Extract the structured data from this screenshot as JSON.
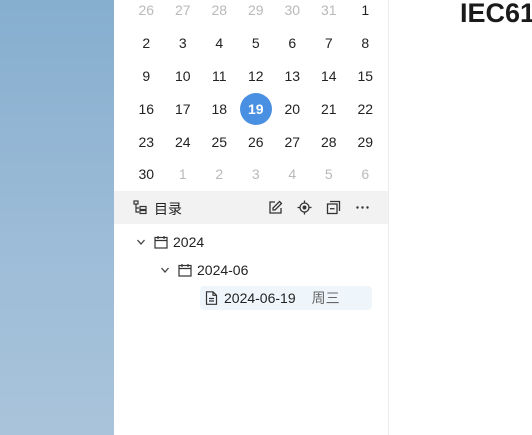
{
  "document": {
    "title": "IEC61"
  },
  "calendar": {
    "rows": [
      [
        {
          "d": "26",
          "m": true
        },
        {
          "d": "27",
          "m": true
        },
        {
          "d": "28",
          "m": true
        },
        {
          "d": "29",
          "m": true
        },
        {
          "d": "30",
          "m": true
        },
        {
          "d": "31",
          "m": true
        },
        {
          "d": "1",
          "m": false
        }
      ],
      [
        {
          "d": "2",
          "m": false
        },
        {
          "d": "3",
          "m": false
        },
        {
          "d": "4",
          "m": false
        },
        {
          "d": "5",
          "m": false
        },
        {
          "d": "6",
          "m": false
        },
        {
          "d": "7",
          "m": false
        },
        {
          "d": "8",
          "m": false
        }
      ],
      [
        {
          "d": "9",
          "m": false
        },
        {
          "d": "10",
          "m": false
        },
        {
          "d": "11",
          "m": false
        },
        {
          "d": "12",
          "m": false
        },
        {
          "d": "13",
          "m": false
        },
        {
          "d": "14",
          "m": false
        },
        {
          "d": "15",
          "m": false
        }
      ],
      [
        {
          "d": "16",
          "m": false
        },
        {
          "d": "17",
          "m": false
        },
        {
          "d": "18",
          "m": false
        },
        {
          "d": "19",
          "m": false,
          "today": true
        },
        {
          "d": "20",
          "m": false
        },
        {
          "d": "21",
          "m": false
        },
        {
          "d": "22",
          "m": false
        }
      ],
      [
        {
          "d": "23",
          "m": false
        },
        {
          "d": "24",
          "m": false
        },
        {
          "d": "25",
          "m": false
        },
        {
          "d": "26",
          "m": false
        },
        {
          "d": "27",
          "m": false
        },
        {
          "d": "28",
          "m": false
        },
        {
          "d": "29",
          "m": false
        }
      ],
      [
        {
          "d": "30",
          "m": false
        },
        {
          "d": "1",
          "m": true
        },
        {
          "d": "2",
          "m": true
        },
        {
          "d": "3",
          "m": true
        },
        {
          "d": "4",
          "m": true
        },
        {
          "d": "5",
          "m": true
        },
        {
          "d": "6",
          "m": true
        }
      ]
    ],
    "accent": "#4a90e2"
  },
  "toolbar": {
    "title": "目录",
    "icons": [
      "outline-icon",
      "edit-icon",
      "locate-icon",
      "collapse-icon",
      "more-icon"
    ]
  },
  "tree": {
    "year": {
      "label": "2024"
    },
    "month": {
      "label": "2024-06"
    },
    "file": {
      "label": "2024-06-19",
      "weekday": "周三"
    }
  }
}
